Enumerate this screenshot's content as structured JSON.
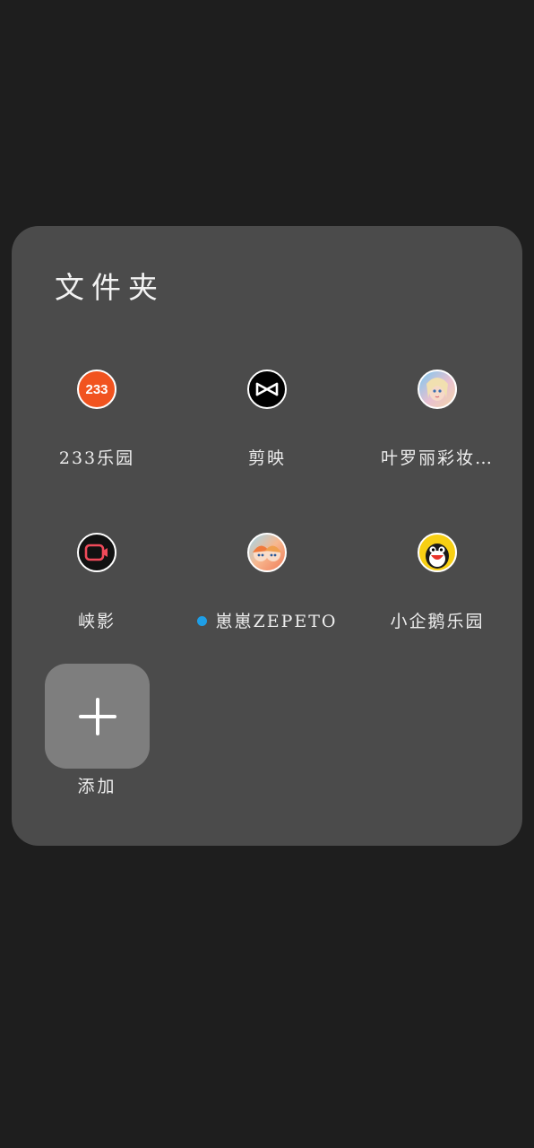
{
  "folder": {
    "title": "文件夹"
  },
  "apps": [
    {
      "label": "233乐园",
      "icon": "233-leyuan-icon",
      "badge_text": "233",
      "dot": false
    },
    {
      "label": "剪映",
      "icon": "capcut-icon",
      "dot": false
    },
    {
      "label": "叶罗丽彩妆…",
      "icon": "yeluoli-doll-icon",
      "dot": false
    },
    {
      "label": "峡影",
      "icon": "video-recorder-icon",
      "dot": false
    },
    {
      "label": "崽崽ZEPETO",
      "icon": "zepeto-avatar-icon",
      "dot": true,
      "dot_color": "#1e9ee6"
    },
    {
      "label": "小企鹅乐园",
      "icon": "penguin-icon",
      "dot": false
    }
  ],
  "add": {
    "label": "添加",
    "icon": "plus-icon"
  },
  "colors": {
    "background": "#1e1e1e",
    "panel": "#4b4b4b",
    "add_tile": "#7e7e7e",
    "dot": "#1e9ee6"
  }
}
